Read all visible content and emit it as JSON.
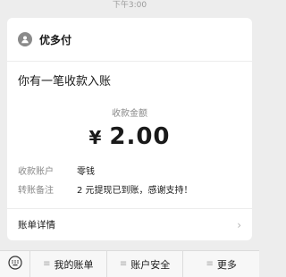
{
  "status_bar": {
    "time": "下午3:00"
  },
  "card": {
    "brand": {
      "icon": "user-icon",
      "name": "优多付"
    },
    "headline": "你有一笔收款入账",
    "amount_label": "收款金额",
    "currency": "¥",
    "amount": "2.00",
    "fields": [
      {
        "key": "收款账户",
        "value": "零钱"
      },
      {
        "key": "转账备注",
        "value": "2 元提现已到账，感谢支持！"
      }
    ],
    "details_label": "账单详情",
    "details_chevron": "›"
  },
  "bottom_bar": {
    "keyboard_icon": "keyboard-icon",
    "menus": [
      {
        "icon": "≡",
        "label": "我的账单"
      },
      {
        "icon": "≡",
        "label": "账户安全"
      },
      {
        "icon": "≡",
        "label": "更多"
      }
    ]
  }
}
